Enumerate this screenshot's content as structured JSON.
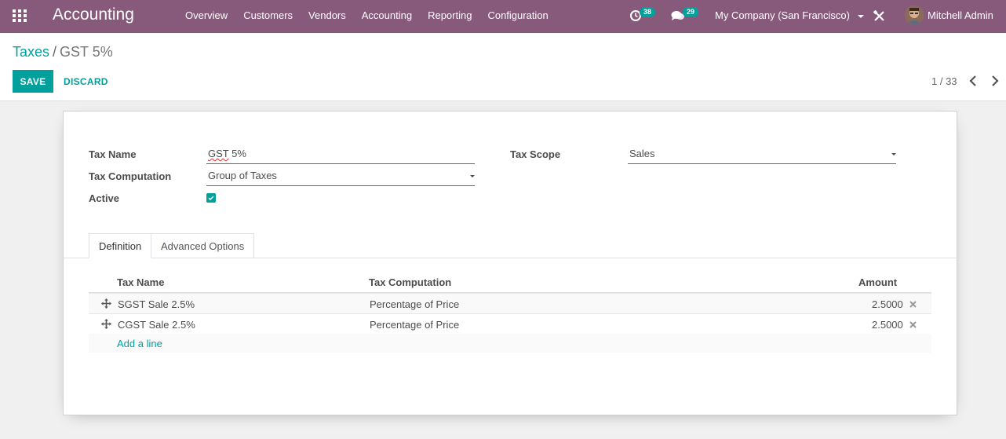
{
  "navbar": {
    "app_title": "Accounting",
    "menu": [
      "Overview",
      "Customers",
      "Vendors",
      "Accounting",
      "Reporting",
      "Configuration"
    ],
    "activity_count": "38",
    "messages_count": "29",
    "company": "My Company (San Francisco)",
    "user": "Mitchell Admin",
    "color": "#875a7b"
  },
  "breadcrumb": {
    "parent": "Taxes",
    "current": "GST 5%"
  },
  "toolbar": {
    "save_label": "SAVE",
    "discard_label": "DISCARD",
    "pager": "1 / 33"
  },
  "form": {
    "tax_name_label": "Tax Name",
    "tax_name_value": "GST",
    "tax_name_suffix": " 5%",
    "tax_computation_label": "Tax Computation",
    "tax_computation_value": "Group of Taxes",
    "active_label": "Active",
    "active_checked": true,
    "tax_scope_label": "Tax Scope",
    "tax_scope_value": "Sales"
  },
  "tabs": [
    "Definition",
    "Advanced Options"
  ],
  "table": {
    "headers": [
      "Tax Name",
      "Tax Computation",
      "Amount"
    ],
    "rows": [
      {
        "name": "SGST Sale 2.5%",
        "computation": "Percentage of Price",
        "amount": "2.5000"
      },
      {
        "name": "CGST Sale 2.5%",
        "computation": "Percentage of Price",
        "amount": "2.5000"
      }
    ],
    "add_line": "Add a line"
  },
  "accent_color": "#00a09d"
}
